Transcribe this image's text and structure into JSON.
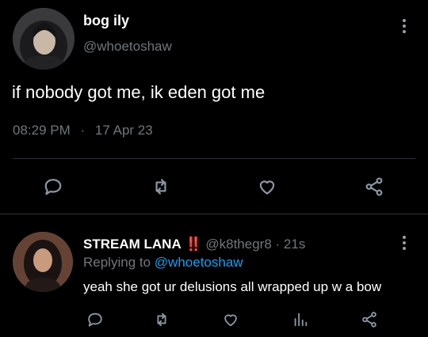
{
  "tweet": {
    "display_name": "bog ily",
    "handle": "@whoetoshaw",
    "text": "if nobody got me, ik eden got me",
    "time": "08:29 PM",
    "separator": "·",
    "date": "17 Apr 23"
  },
  "reply": {
    "display_name": "STREAM LANA",
    "emoji": "‼️",
    "handle": "@k8thegr8",
    "separator": "·",
    "time_ago": "21s",
    "replying_prefix": "Replying to",
    "replying_handle": "@whoetoshaw",
    "text": "yeah she got ur delusions all wrapped up w a bow"
  },
  "colors": {
    "background": "#000000",
    "text": "#e7e9ea",
    "muted": "#71767b",
    "accent": "#1d9bf0",
    "emoji_red": "#e0245e"
  },
  "icons": [
    "reply-icon",
    "retweet-icon",
    "like-icon",
    "share-icon",
    "analytics-icon",
    "more-icon"
  ]
}
